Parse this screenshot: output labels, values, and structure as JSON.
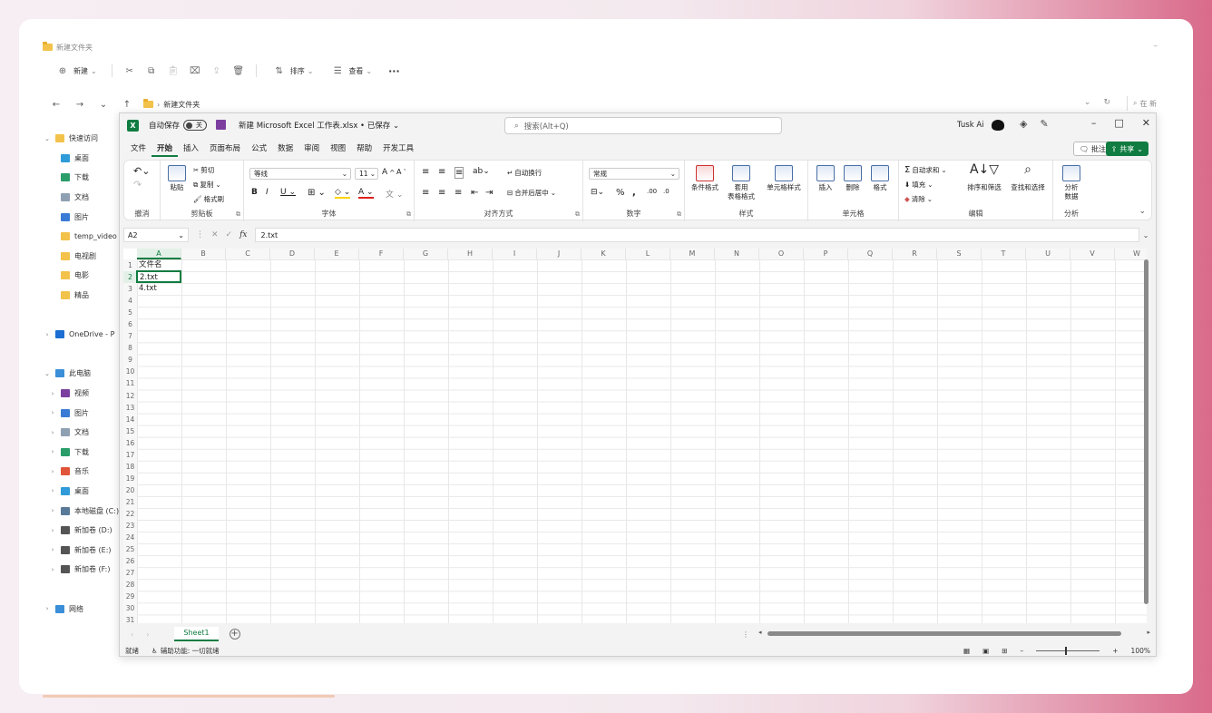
{
  "explorer": {
    "title": "新建文件夹",
    "toolbar": {
      "new_label": "新建",
      "sort_label": "排序",
      "view_label": "查看",
      "more_label": "···"
    },
    "breadcrumb": "新建文件夹",
    "search_placeholder": "在 新",
    "sidebar": [
      {
        "label": "快速访问",
        "level": 0,
        "chev": "⌄",
        "color": "#f3c24a"
      },
      {
        "label": "桌面",
        "level": 1,
        "color": "#2f9bd8"
      },
      {
        "label": "下载",
        "level": 1,
        "color": "#2a9d6a"
      },
      {
        "label": "文档",
        "level": 1,
        "color": "#8fa0b3"
      },
      {
        "label": "图片",
        "level": 1,
        "color": "#3a7bd5"
      },
      {
        "label": "temp_video",
        "level": 1,
        "color": "#f3c24a"
      },
      {
        "label": "电视剧",
        "level": 1,
        "color": "#f3c24a"
      },
      {
        "label": "电影",
        "level": 1,
        "color": "#f3c24a"
      },
      {
        "label": "精品",
        "level": 1,
        "color": "#f3c24a"
      },
      {
        "label": "",
        "level": 0,
        "color": ""
      },
      {
        "label": "OneDrive - P",
        "level": 0,
        "chev": "›",
        "color": "#1c6ed2"
      },
      {
        "label": "",
        "level": 0,
        "color": ""
      },
      {
        "label": "此电脑",
        "level": 0,
        "chev": "⌄",
        "color": "#3a8fd8"
      },
      {
        "label": "视频",
        "level": 1,
        "chev": "›",
        "color": "#7b3fa0"
      },
      {
        "label": "图片",
        "level": 1,
        "chev": "›",
        "color": "#3a7bd5"
      },
      {
        "label": "文档",
        "level": 1,
        "chev": "›",
        "color": "#8fa0b3"
      },
      {
        "label": "下载",
        "level": 1,
        "chev": "›",
        "color": "#2a9d6a"
      },
      {
        "label": "音乐",
        "level": 1,
        "chev": "›",
        "color": "#e0553a"
      },
      {
        "label": "桌面",
        "level": 1,
        "chev": "›",
        "color": "#2f9bd8"
      },
      {
        "label": "本地磁盘 (C:)",
        "level": 1,
        "chev": "›",
        "color": "#5a7a99"
      },
      {
        "label": "新加卷 (D:)",
        "level": 1,
        "chev": "›",
        "color": "#555555"
      },
      {
        "label": "新加卷 (E:)",
        "level": 1,
        "chev": "›",
        "color": "#555555"
      },
      {
        "label": "新加卷 (F:)",
        "level": 1,
        "chev": "›",
        "color": "#555555"
      },
      {
        "label": "",
        "level": 0,
        "color": ""
      },
      {
        "label": "网络",
        "level": 0,
        "chev": "›",
        "color": "#3a8fd8"
      }
    ]
  },
  "excel": {
    "autosave_label": "自动保存",
    "autosave_state": "关",
    "doc_title": "新建 Microsoft Excel 工作表.xlsx • 已保存 ⌄",
    "search_placeholder": "搜索(Alt+Q)",
    "user_name": "Tusk Ai",
    "tabs": [
      "文件",
      "开始",
      "插入",
      "页面布局",
      "公式",
      "数据",
      "审阅",
      "视图",
      "帮助",
      "开发工具"
    ],
    "active_tab": "开始",
    "comment_label": "批注",
    "share_label": "共享",
    "ribbon": {
      "undo_group": "撤消",
      "clipboard": {
        "paste": "粘贴",
        "cut": "剪切",
        "copy": "复制",
        "painter": "格式刷",
        "group": "剪贴板"
      },
      "font": {
        "name": "等线",
        "size": "11",
        "group": "字体"
      },
      "alignment": {
        "wrap": "自动换行",
        "merge": "合并后居中",
        "group": "对齐方式"
      },
      "number": {
        "format": "常规",
        "group": "数字"
      },
      "styles": {
        "cond": "条件格式",
        "table1": "套用",
        "table2": "表格格式",
        "cell": "单元格样式",
        "group": "样式"
      },
      "cells": {
        "insert": "插入",
        "delete": "删除",
        "format": "格式",
        "group": "单元格"
      },
      "editing": {
        "autosum": "自动求和",
        "fill": "填充",
        "clear": "清除",
        "sort": "排序和筛选",
        "find": "查找和选择",
        "group": "编辑"
      },
      "analysis": {
        "btn1": "分析",
        "btn2": "数据",
        "group": "分析"
      }
    },
    "name_box": "A2",
    "formula_value": "2.txt",
    "columns": [
      "A",
      "B",
      "C",
      "D",
      "E",
      "F",
      "G",
      "H",
      "I",
      "J",
      "K",
      "L",
      "M",
      "N",
      "O",
      "P",
      "Q",
      "R",
      "S",
      "T",
      "U",
      "V",
      "W"
    ],
    "rows": [
      "1",
      "2",
      "3",
      "4",
      "5",
      "6",
      "7",
      "8",
      "9",
      "10",
      "11",
      "12",
      "13",
      "14",
      "15",
      "16",
      "17",
      "18",
      "19",
      "20",
      "21",
      "22",
      "23",
      "24",
      "25",
      "26",
      "27",
      "28",
      "29",
      "30",
      "31"
    ],
    "cells": {
      "a1": "文件名",
      "a2": "2.txt",
      "a3": "4.txt"
    },
    "sheet_name": "Sheet1",
    "status_ready": "就绪",
    "status_accessibility": "辅助功能: 一切就绪",
    "zoom": "100%"
  }
}
